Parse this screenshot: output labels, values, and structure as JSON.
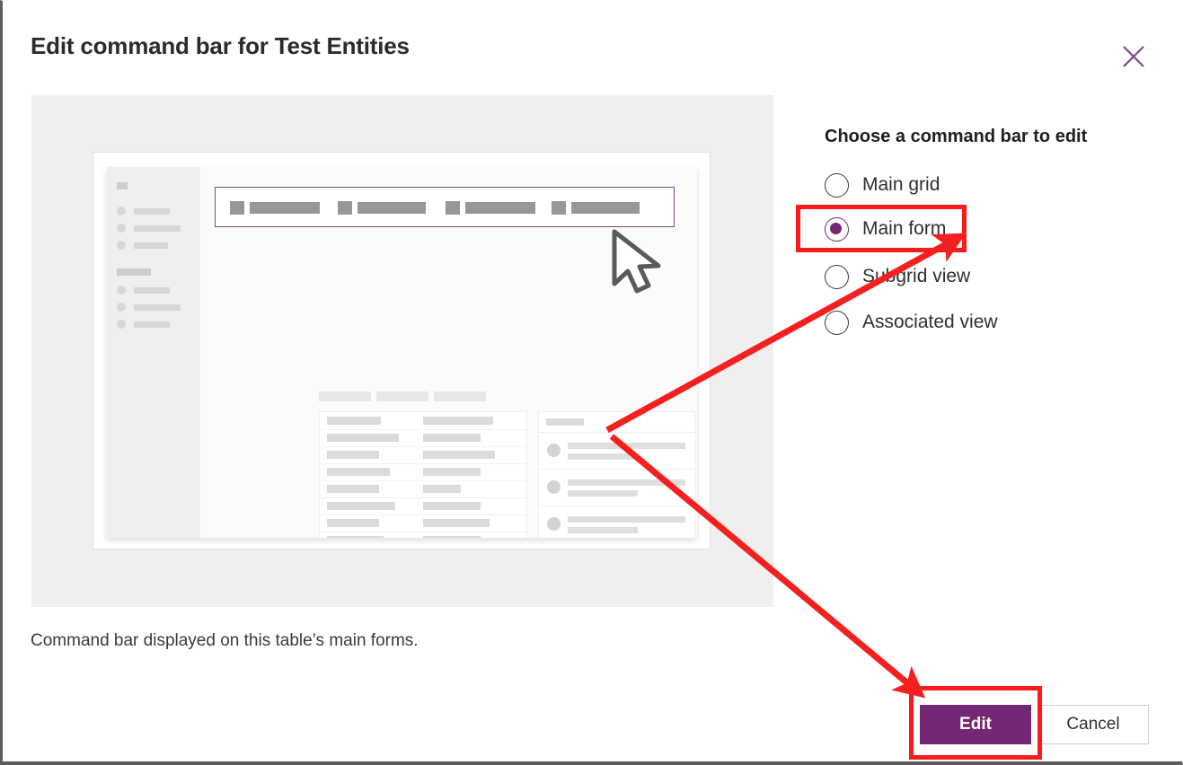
{
  "dialog": {
    "title": "Edit command bar for Test Entities",
    "close_icon": "close-icon",
    "caption": "Command bar displayed on this table’s main forms."
  },
  "choose": {
    "label": "Choose a command bar to edit",
    "options": [
      {
        "label": "Main grid",
        "selected": false
      },
      {
        "label": "Main form",
        "selected": true
      },
      {
        "label": "Subgrid view",
        "selected": false
      },
      {
        "label": "Associated view",
        "selected": false
      }
    ]
  },
  "footer": {
    "primary_label": "Edit",
    "secondary_label": "Cancel"
  },
  "annotations": {
    "highlight_color": "#fb1b1b",
    "arrow_color": "#f42020",
    "highlighted_elements": [
      "Main form",
      "Edit"
    ]
  },
  "colors": {
    "accent_purple": "#742774",
    "command_bar_outline": "#7b4b7f",
    "preview_background": "#f0efee",
    "close_icon": "#7a4b7f"
  },
  "preview": {
    "name": "main-form-command-bar-preview",
    "highlighted_region": "command-bar",
    "cursor_icon": "mouse-pointer-icon"
  }
}
